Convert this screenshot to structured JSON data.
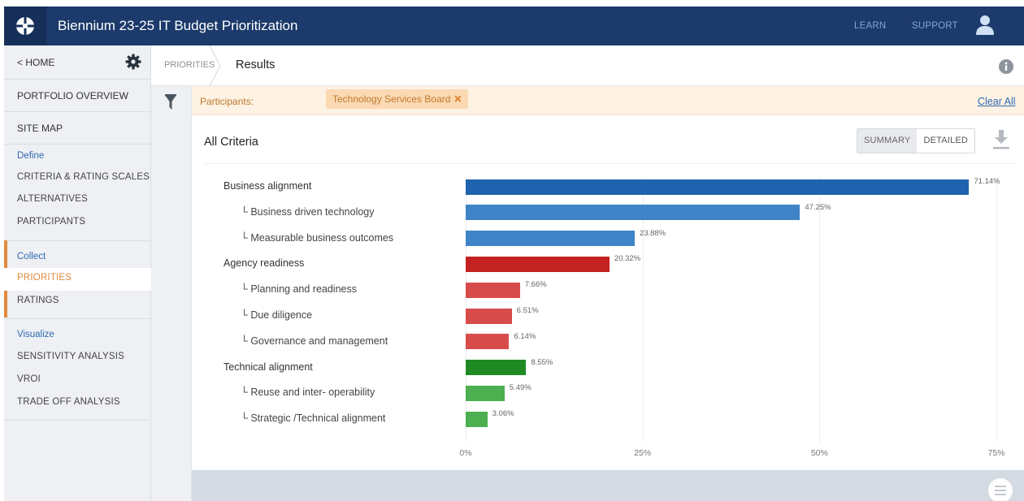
{
  "app": {
    "title": "Biennium 23-25 IT Budget Prioritization"
  },
  "header": {
    "learn": "LEARN",
    "support": "SUPPORT",
    "logo_icon": "compass-logo-icon",
    "user_icon": "user-icon"
  },
  "sidebar": {
    "home": "< HOME",
    "portfolio_overview": "PORTFOLIO OVERVIEW",
    "site_map": "SITE MAP",
    "sections": [
      {
        "heading": "Define",
        "items": [
          "CRITERIA & RATING SCALES",
          "ALTERNATIVES",
          "PARTICIPANTS"
        ]
      },
      {
        "heading": "Collect",
        "items": [
          "PRIORITIES",
          "RATINGS"
        ]
      },
      {
        "heading": "Visualize",
        "items": [
          "SENSITIVITY ANALYSIS",
          "VROI",
          "TRADE OFF ANALYSIS"
        ]
      }
    ],
    "active_item": "PRIORITIES",
    "active_color": "#e08a3c"
  },
  "breadcrumb": {
    "parent": "PRIORITIES",
    "current": "Results"
  },
  "filter": {
    "label": "Participants:",
    "chip": "Technology Services Board",
    "chip_remove": "✕",
    "clear_all": "Clear All"
  },
  "panel": {
    "title": "All Criteria",
    "toggle": {
      "summary": "SUMMARY",
      "detailed": "DETAILED",
      "selected": "DETAILED"
    }
  },
  "chart_data": {
    "type": "bar",
    "orientation": "horizontal",
    "xlim": [
      0,
      75
    ],
    "xticks": [
      "0%",
      "25%",
      "50%",
      "75%"
    ],
    "categories": [
      "Business alignment",
      "Business driven technology",
      "Measurable business outcomes",
      "Agency readiness",
      "Planning and readiness",
      "Due diligence",
      "Governance and management",
      "Technical alignment",
      "Reuse and inter- operability",
      "Strategic /Technical alignment"
    ],
    "is_sub": [
      false,
      true,
      true,
      false,
      true,
      true,
      true,
      false,
      true,
      true
    ],
    "values": [
      71.14,
      47.25,
      23.88,
      20.32,
      7.66,
      6.51,
      6.14,
      8.55,
      5.49,
      3.06
    ],
    "labels": [
      "71.14%",
      "47.25%",
      "23.88%",
      "20.32%",
      "7.66%",
      "6.51%",
      "6.14%",
      "8.55%",
      "5.49%",
      "3.06%"
    ],
    "colors": [
      "#1f63ae",
      "#3f84c7",
      "#3f84c7",
      "#c42220",
      "#d84b4b",
      "#d84b4b",
      "#d84b4b",
      "#1f8a24",
      "#4caf50",
      "#4caf50"
    ],
    "grid": true
  }
}
